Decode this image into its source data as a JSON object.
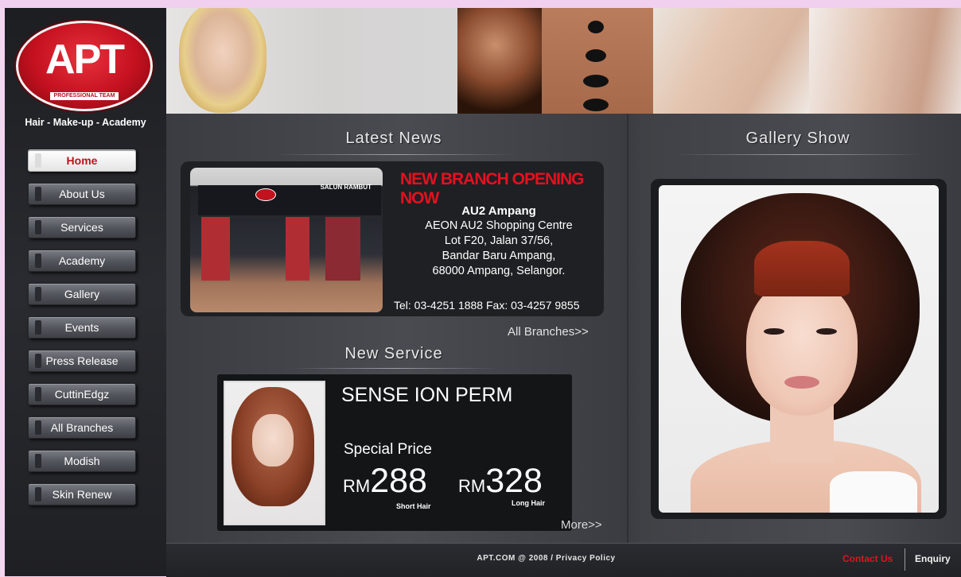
{
  "brand": {
    "logo_text": "APT",
    "logo_subtext": "PROFESSIONAL TEAM",
    "tagline": "Hair - Make-up - Academy"
  },
  "nav": {
    "items": [
      {
        "label": "Home",
        "active": true
      },
      {
        "label": "About Us"
      },
      {
        "label": "Services"
      },
      {
        "label": "Academy"
      },
      {
        "label": "Gallery"
      },
      {
        "label": "Events"
      },
      {
        "label": "Press Release"
      },
      {
        "label": "CuttinEdgz"
      },
      {
        "label": "All Branches"
      },
      {
        "label": "Modish"
      },
      {
        "label": "Skin Renew"
      }
    ]
  },
  "news": {
    "title": "Latest News",
    "headline": "NEW BRANCH OPENING NOW",
    "branch_name": "AU2 Ampang",
    "address_lines": [
      "AEON AU2 Shopping Centre",
      "Lot F20, Jalan 37/56,",
      "Bandar Baru Ampang,",
      "68000 Ampang, Selangor."
    ],
    "contact": "Tel: 03-4251 1888  Fax: 03-4257 9855",
    "photo_sign": "SALUN RAMBUT",
    "photo_badge": "APT",
    "link": "All Branches>>"
  },
  "service": {
    "title": "New Service",
    "name": "SENSE ION PERM",
    "price_heading": "Special Price",
    "prices": [
      {
        "currency": "RM",
        "amount": "288",
        "note": "Short Hair"
      },
      {
        "currency": "RM",
        "amount": "328",
        "note": "Long Hair"
      }
    ],
    "link": "More>>"
  },
  "gallery": {
    "title": "Gallery Show"
  },
  "footer": {
    "copyright": "APT.COM @ 2008 / Privacy Policy",
    "contact": "Contact Us",
    "enquiry": "Enquiry"
  },
  "colors": {
    "accent_red": "#e4111f",
    "page_bg": "#f3d6ef",
    "panel_dark": "#1f2023"
  }
}
